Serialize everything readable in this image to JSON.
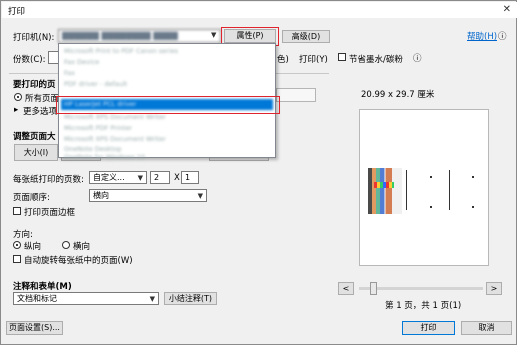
{
  "window": {
    "title": "打印",
    "close_glyph": "✕"
  },
  "printer": {
    "label": "打印机(N):",
    "value": "▇▇▇▇▇▇ ▇▇▇▇▇▇▇▇ ▇▇▇▇",
    "properties_label": "属性(P)",
    "advanced_label": "高级(D)",
    "help_label": "帮助(H)",
    "help_icon": "ⓘ"
  },
  "copies": {
    "label": "份数(C):",
    "color_label": "色)",
    "print_label": "打印(Y)",
    "save_ink_label": "节省墨水/碳粉",
    "info_icon": "ⓘ"
  },
  "printer_dropdown": {
    "items": [
      "Microsoft Print to PDF Canon series",
      "Fax Device",
      "Fax",
      "PDF driver - default",
      "HP LaserJet PCL driver",
      "Microsoft XPS Document Writer",
      "Microsoft PDF Printer",
      "Microsoft XPS Document Writer",
      "OneNote Desktop",
      "OneNote for Windows 10"
    ],
    "selected_index": 4
  },
  "pages_section": {
    "title": "要打印的页",
    "all_label": "所有页面",
    "more_options_label": "更多选项"
  },
  "sizing": {
    "title": "调整页面大",
    "size_label": "大小(I)"
  },
  "layout": {
    "pages_per_sheet_label": "每张纸打印的页数:",
    "pages_per_sheet_value": "自定义...",
    "cols": "2",
    "x_label": "X",
    "rows": "1",
    "order_label": "页面顺序:",
    "order_value": "横向",
    "border_label": "打印页面边框"
  },
  "orientation": {
    "title": "方向:",
    "portrait_label": "纵向",
    "landscape_label": "横向",
    "auto_rotate_label": "自动旋转每张纸中的页面(W)"
  },
  "comments": {
    "title": "注释和表单(M)",
    "value": "文档和标记",
    "summarize_label": "小结注释(T)"
  },
  "preview": {
    "size_text": "20.99 x 29.7 厘米",
    "prev_glyph": "<",
    "next_glyph": ">",
    "page_status": "第 1 页，共 1 页(1)"
  },
  "footer": {
    "page_setup_label": "页面设置(S)...",
    "print_label": "打印",
    "cancel_label": "取消"
  },
  "colors": {
    "accent": "#0078d7",
    "highlight_box": "#e0242e"
  }
}
